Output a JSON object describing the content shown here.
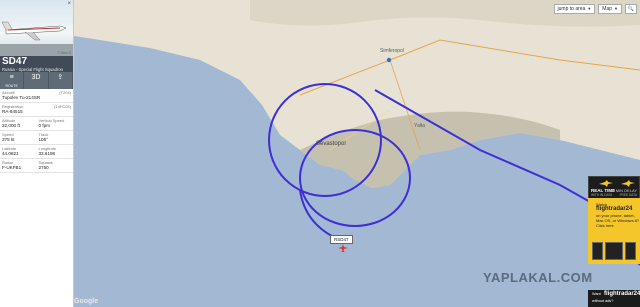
{
  "panel": {
    "close": "×",
    "photo_credit": "© Alex Z",
    "callsign": "SD47",
    "airline": "Russia - Special Flight Squadron",
    "tabs": [
      {
        "label": "≡",
        "sub": "ROUTE"
      },
      {
        "label": "3D",
        "sub": ""
      },
      {
        "label": "⇪",
        "sub": ""
      }
    ],
    "details": [
      [
        {
          "label": "Aircraft",
          "code": "(T204)",
          "value": "Tupolev Tu-214SR"
        }
      ],
      [
        {
          "label": "Registration",
          "code": "(14FC03)",
          "value": "RA-64515"
        }
      ],
      [
        {
          "label": "Altitude",
          "value": "32,000 ft"
        },
        {
          "label": "Vertical Speed",
          "value": "0 fpm"
        }
      ],
      [
        {
          "label": "Speed",
          "value": "375 kt"
        },
        {
          "label": "Track",
          "value": "105°"
        }
      ],
      [
        {
          "label": "Latitude",
          "value": "44.0821"
        },
        {
          "label": "Longitude",
          "value": "33.6198"
        }
      ],
      [
        {
          "label": "Radar",
          "value": "F-UKFB1"
        },
        {
          "label": "Squawk",
          "value": "2750"
        }
      ]
    ]
  },
  "controls": {
    "jump": "jump to area",
    "map_type": "Map",
    "search": "🔍"
  },
  "map": {
    "labels": {
      "sevastopol": "Sevastopol",
      "simferopol": "Simferopol",
      "yalta": "Yalta"
    },
    "plane_tag": "RSD47",
    "watermark": "YAPLAKAL.COM",
    "google": "Google"
  },
  "ads": {
    "ad1": {
      "rt": "REAL TIME",
      "ly": "1 MIN DELAY",
      "s1": "WITH IN-DATA",
      "s2": "FREE DATA"
    },
    "ad2": {
      "w": "Watch",
      "brand": "flightradar24",
      "l3": "on your phone, tablet,",
      "l4": "Mac OS, or Windows 8?",
      "l5": "Click here"
    },
    "ad3": {
      "w": "Want",
      "brand": "flightradar24",
      "l2": "without ads?"
    }
  },
  "colors": {
    "sea": "#a3b8d2",
    "land": "#e8e2d4",
    "track": "#3c2fd6",
    "panel_header": "#404b57"
  }
}
